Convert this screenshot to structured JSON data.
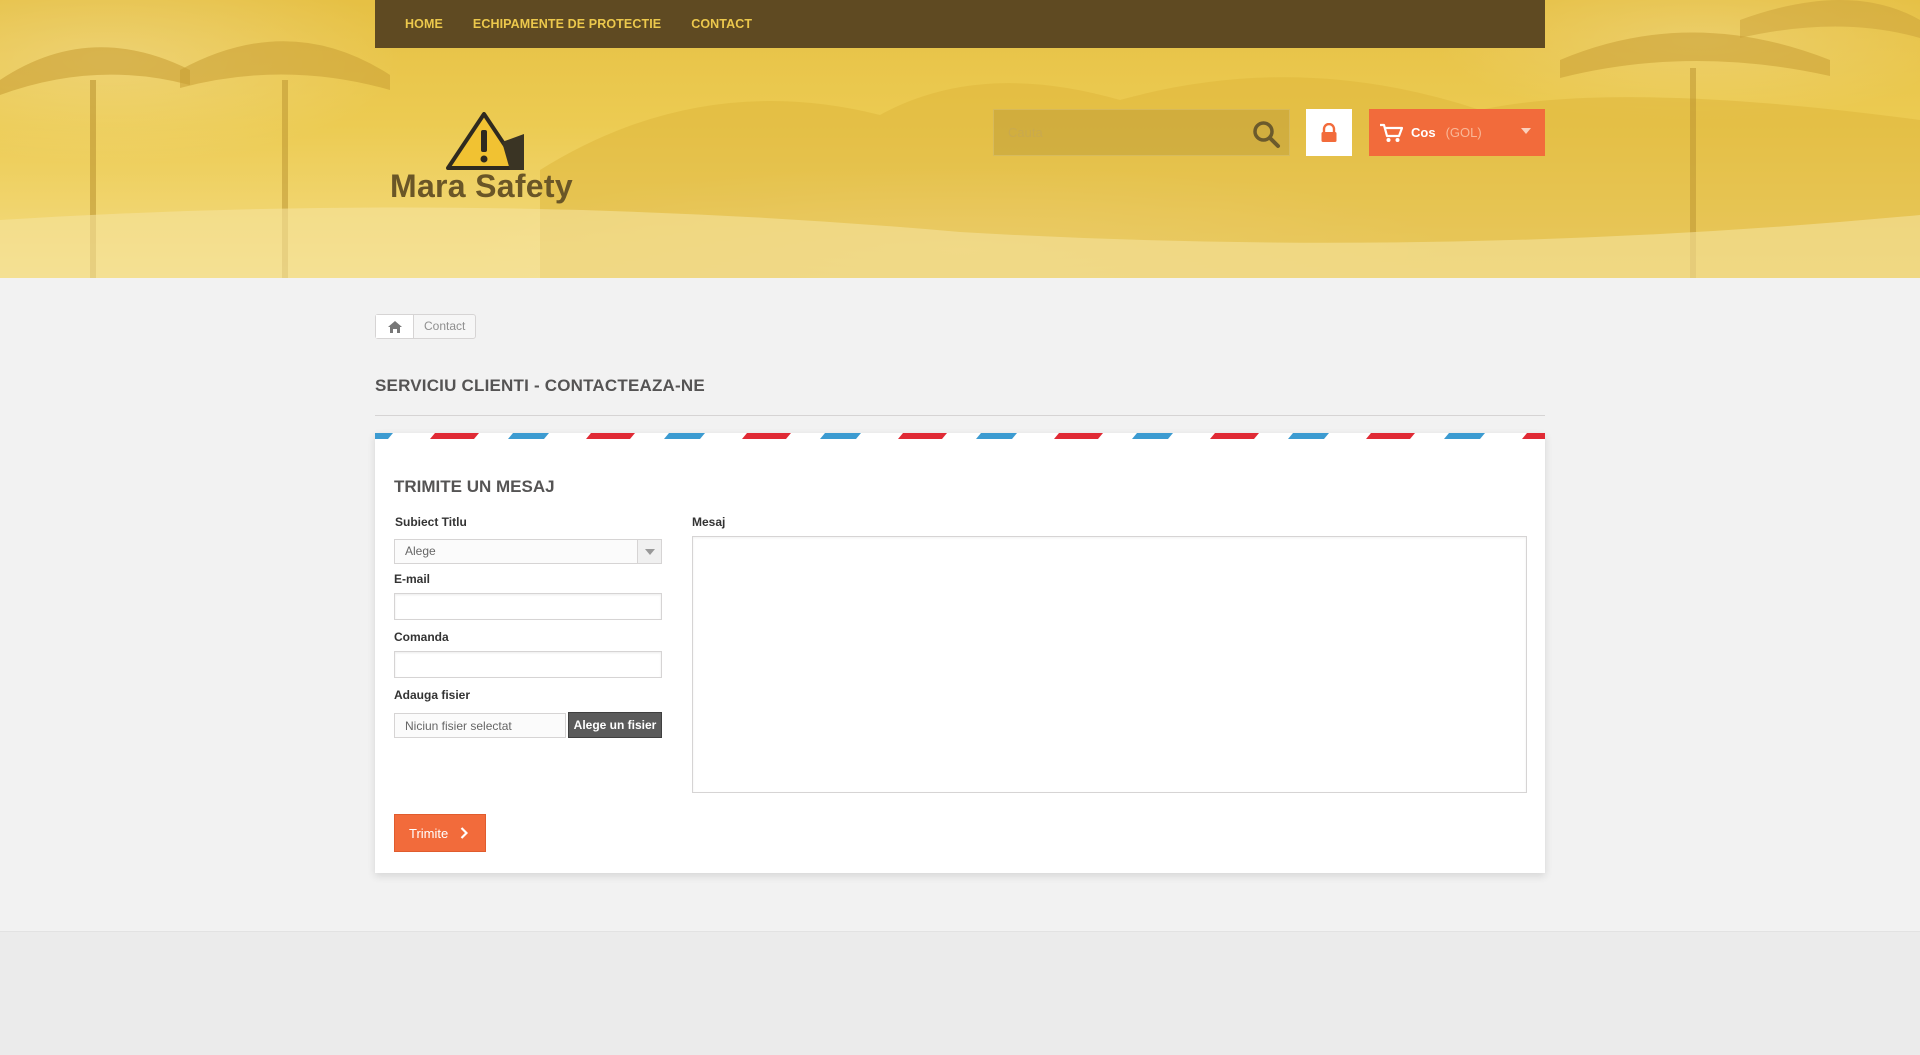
{
  "nav": {
    "items": [
      {
        "label": "HOME"
      },
      {
        "label": "ECHIPAMENTE DE PROTECTIE"
      },
      {
        "label": "CONTACT"
      }
    ]
  },
  "brand": {
    "name": "Mara Safety",
    "logo_icon": "warning-triangle-icon"
  },
  "search": {
    "placeholder": "Cauta",
    "icon": "search-icon"
  },
  "account": {
    "icon": "lock-icon"
  },
  "cart": {
    "label": "Cos",
    "status": "(GOL)",
    "icon": "shopping-cart-icon"
  },
  "breadcrumb": {
    "home_icon": "home-icon",
    "current": "Contact"
  },
  "page": {
    "heading": "SERVICIU CLIENTI - CONTACTEAZA-NE"
  },
  "form": {
    "title": "TRIMITE UN MESAJ",
    "subject_label": "Subiect Titlu",
    "subject_value": "Alege",
    "email_label": "E-mail",
    "email_value": "",
    "order_label": "Comanda",
    "order_value": "",
    "file_label": "Adauga fisier",
    "file_status": "Niciun fisier selectat",
    "file_button": "Alege un fisier",
    "message_label": "Mesaj",
    "message_value": "",
    "submit_label": "Trimite"
  },
  "colors": {
    "header_yellow": "#ecc84c",
    "nav_brown": "#5f4a22",
    "accent_orange": "#f26b3b",
    "airmail_red": "#e02a35",
    "airmail_blue": "#3c9bd1"
  }
}
